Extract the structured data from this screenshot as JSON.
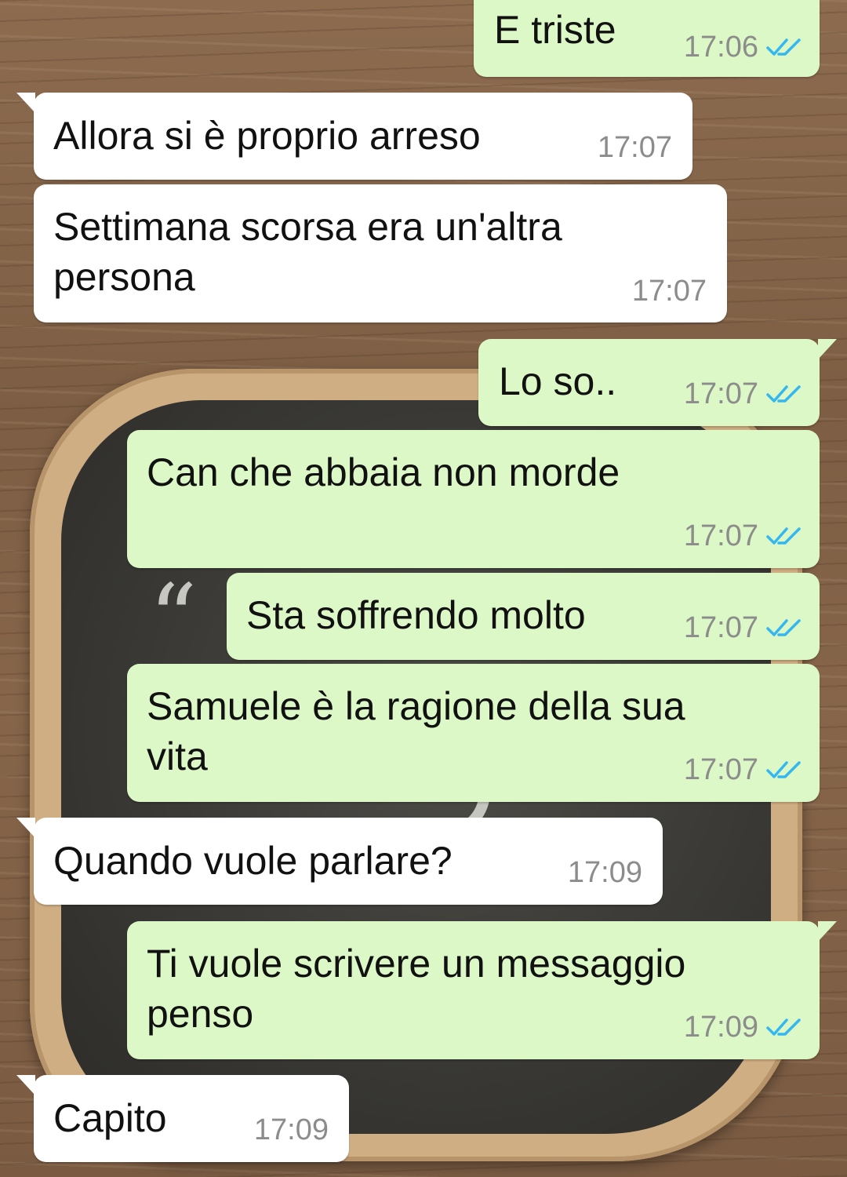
{
  "colors": {
    "incoming_bubble": "#ffffff",
    "outgoing_bubble": "#dcf8c6",
    "read_ticks": "#34b7f1",
    "timestamp": "#8c8c8c"
  },
  "messages": [
    {
      "direction": "out",
      "text": "E triste",
      "time": "17:06",
      "status": "read",
      "status_icon": "double-check-icon"
    },
    {
      "direction": "in",
      "text": "Allora si è proprio arreso",
      "time": "17:07"
    },
    {
      "direction": "in",
      "text": "Settimana scorsa era un'altra persona",
      "time": "17:07"
    },
    {
      "direction": "out",
      "text": "Lo so..",
      "time": "17:07",
      "status": "read",
      "status_icon": "double-check-icon"
    },
    {
      "direction": "out",
      "text": "Can che abbaia non morde",
      "time": "17:07",
      "status": "read",
      "status_icon": "double-check-icon"
    },
    {
      "direction": "out",
      "text": "Sta soffrendo molto",
      "time": "17:07",
      "status": "read",
      "status_icon": "double-check-icon"
    },
    {
      "direction": "out",
      "text": "Samuele è la ragione della sua vita",
      "time": "17:07",
      "status": "read",
      "status_icon": "double-check-icon"
    },
    {
      "direction": "in",
      "text": "Quando vuole parlare?",
      "time": "17:09"
    },
    {
      "direction": "out",
      "text": "Ti vuole scrivere un messaggio penso",
      "time": "17:09",
      "status": "read",
      "status_icon": "double-check-icon"
    },
    {
      "direction": "in",
      "text": "Capito",
      "time": "17:09"
    }
  ]
}
